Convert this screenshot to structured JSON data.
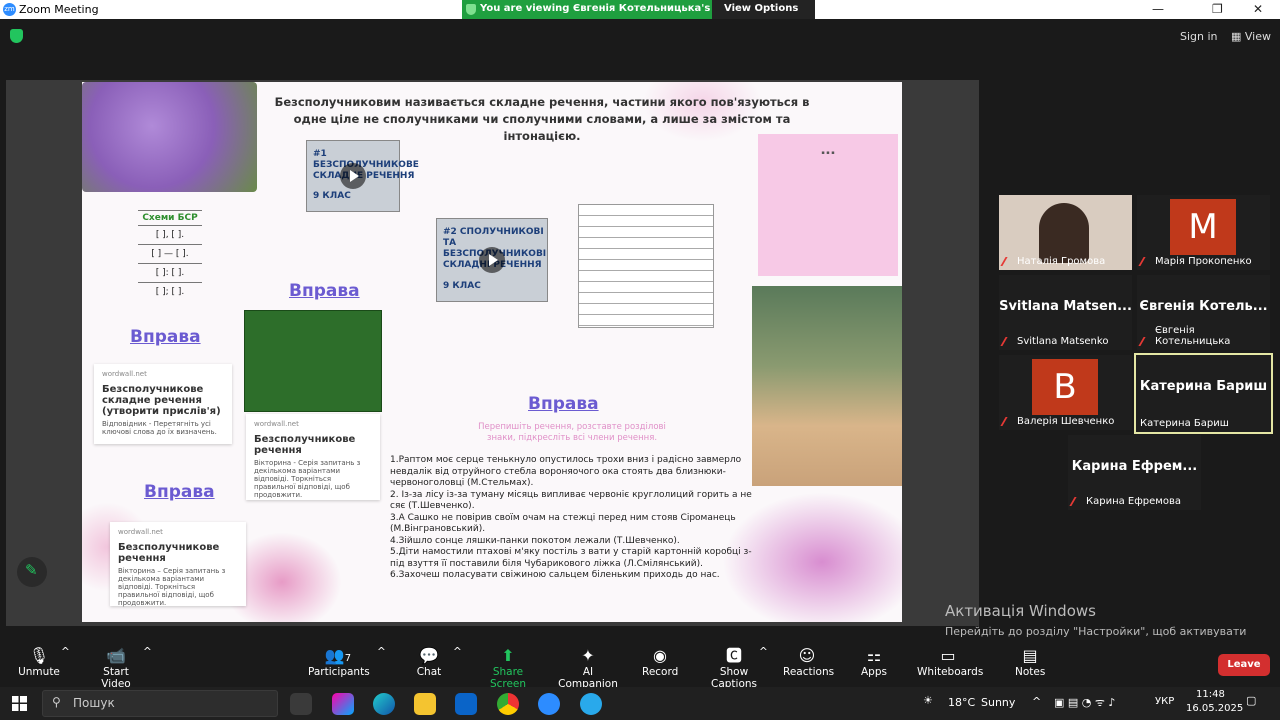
{
  "window": {
    "title": "Zoom Meeting",
    "minimize": "—",
    "maximize": "❐",
    "close": "✕"
  },
  "banner": {
    "message": "You are viewing Євгенія Котельницька's screen",
    "view_options": "View Options",
    "view_options_caret": "⌄"
  },
  "topbar": {
    "sign_in": "Sign in",
    "view": "View"
  },
  "slide": {
    "heading": "Безсполучниковим називається складне речення, частини якого пов'язуються в одне ціле не сполучниками чи сполучними словами, а лише за змістом та інтонацією.",
    "video1_title": "#1 БЕЗСПОЛУЧНИКОВЕ СКЛАДНЕ РЕЧЕННЯ",
    "video1_grade": "9 КЛАС",
    "video2_title": "#2 СПОЛУЧНИКОВІ ТА БЕЗСПОЛУЧНИКОВІ СКЛАДНІ РЕЧЕННЯ",
    "video2_grade": "9 КЛАС",
    "schemes_title": "Схеми БСР",
    "schemes": [
      "[ ], [ ].",
      "[ ] — [ ].",
      "[ ]: [ ].",
      "[ ]; [ ]."
    ],
    "vprava_left1": "Вправа",
    "vprava_mid": "Вправа",
    "vprava_left2": "Вправа",
    "vprava_center": "Вправа",
    "card1": {
      "source": "wordwall.net",
      "title": "Безсполучникове складне речення (утворити прислів'я)",
      "desc": "Відповідник - Перетягніть усі ключові слова до їх визначень."
    },
    "card2": {
      "source": "wordwall.net",
      "title": "Безсполучникове речення",
      "desc": "Вікторина - Серія запитань з декількома варіантами відповіді. Торкніться правильної відповіді, щоб продовжити."
    },
    "card3": {
      "source": "wordwall.net",
      "title": "Безсполучникове речення",
      "desc": "Вікторина – Серія запитань з декількома варіантами відповіді. Торкніться правильної відповіді, щоб продовжити."
    },
    "instruction": "Перепишіть речення, розставте розділові знаки, підкресліть всі члени речення.",
    "sentences": [
      "1.Раптом моє серце тенькнуло опустилось трохи вниз і радісно завмерло невдалік від отруйного стебла вороняочого ока стоять два близнюки-червоноголовці (М.Стельмах).",
      "2. Із-за лісу із-за туману місяць випливає червоніє круглолиций горить а не сяє (Т.Шевченко).",
      "3.А Сашко не повірив своїм очам на стежці перед ним стояв Сіроманець (М.Вінграновський).",
      "4.Зійшло сонце ляшки-панки покотом лежали (Т.Шевченко).",
      "5.Діти намостили птахові м'яку постіль з вати у старій картонній коробці з-під взуття її поставили біля Чубарикового ліжка (Л.Смілянський).",
      "6.Захочеш поласувати свіжиною сальцем біленьким приходь до нас."
    ]
  },
  "participants": [
    {
      "name": "Наталія Громова",
      "big": ""
    },
    {
      "name": "Марія Прокопенко",
      "big": "M"
    },
    {
      "name": "Svitlana Matsenko",
      "big": "Svitlana Matsen..."
    },
    {
      "name": "Євгенія Котельницька",
      "big": "Євгенія Котель..."
    },
    {
      "name": "Валерія Шевченко",
      "big": "B"
    },
    {
      "name": "Катерина Бариш",
      "big": "Катерина Бариш"
    },
    {
      "name": "Карина Ефремова",
      "big": "Карина Ефрем..."
    }
  ],
  "activation": {
    "title": "Активація Windows",
    "desc": "Перейдіть до розділу \"Настройки\", щоб активувати Windows."
  },
  "toolbar": {
    "unmute": "Unmute",
    "start_video": "Start Video",
    "participants": "Participants",
    "participants_count": "7",
    "chat": "Chat",
    "share": "Share Screen",
    "ai": "AI Companion",
    "record": "Record",
    "captions": "Show Captions",
    "reactions": "Reactions",
    "apps": "Apps",
    "whiteboards": "Whiteboards",
    "notes": "Notes",
    "leave": "Leave"
  },
  "taskbar": {
    "search": "Пошук",
    "weather": "18°C",
    "weather_desc": "Sunny",
    "lang": "УКР",
    "time": "11:48",
    "date": "16.05.2025"
  },
  "colors": {
    "banner_green": "#1f9f3f",
    "leave_red": "#d32f2f",
    "active_speaker": "#e4e6a4",
    "link_purple": "#6b5bd1"
  }
}
